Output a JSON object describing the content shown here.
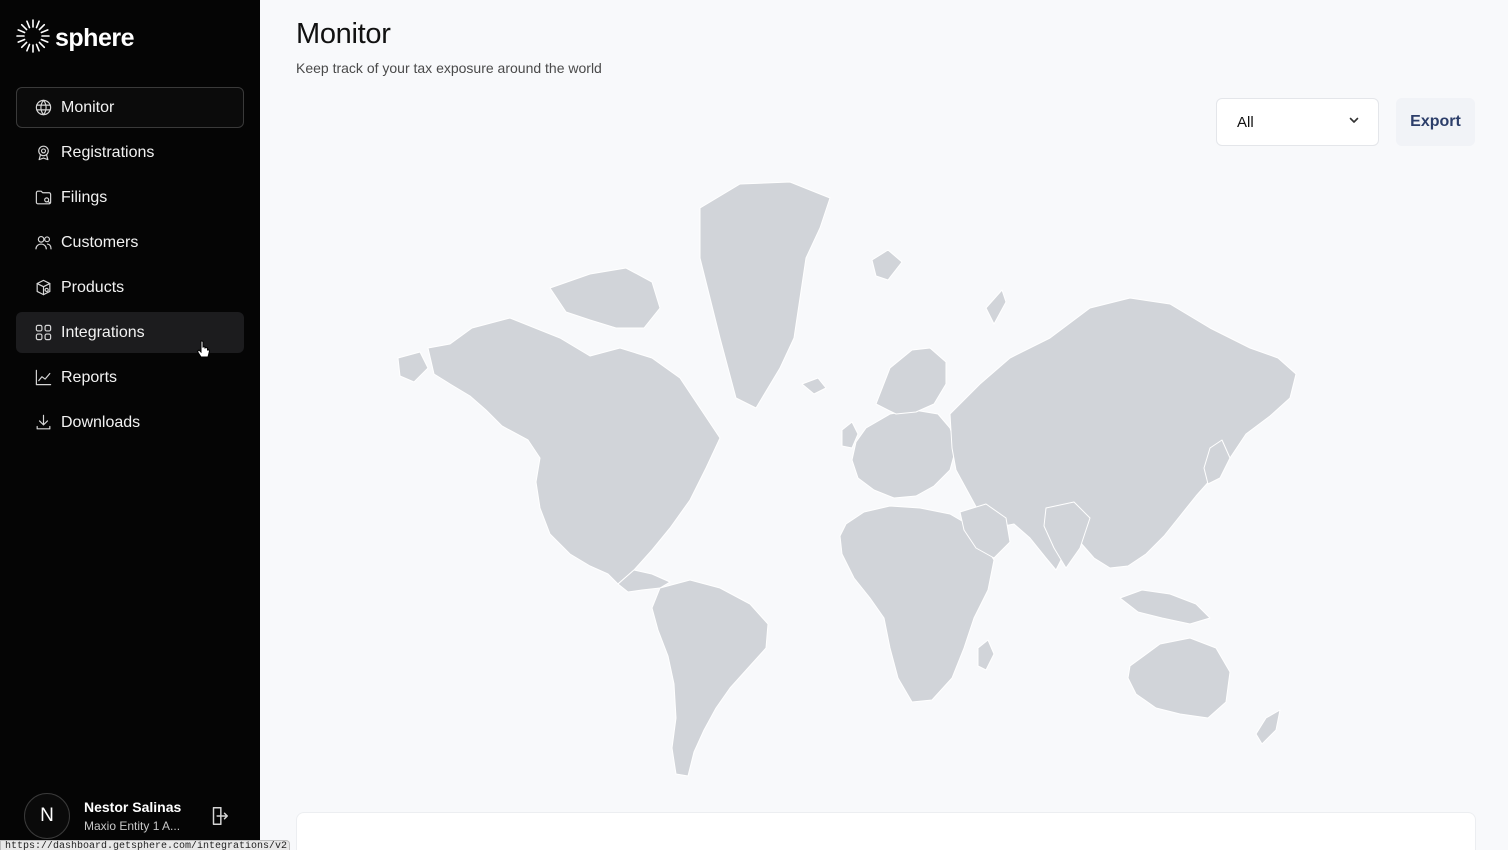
{
  "brand": {
    "name": "sphere"
  },
  "nav": {
    "items": [
      {
        "label": "Monitor",
        "icon": "globe-icon",
        "state": "active"
      },
      {
        "label": "Registrations",
        "icon": "registration-badge-icon",
        "state": ""
      },
      {
        "label": "Filings",
        "icon": "folder-icon",
        "state": ""
      },
      {
        "label": "Customers",
        "icon": "users-icon",
        "state": ""
      },
      {
        "label": "Products",
        "icon": "package-icon",
        "state": ""
      },
      {
        "label": "Integrations",
        "icon": "grid-icon",
        "state": "hover"
      },
      {
        "label": "Reports",
        "icon": "line-chart-icon",
        "state": ""
      },
      {
        "label": "Downloads",
        "icon": "download-icon",
        "state": ""
      }
    ]
  },
  "user": {
    "initial": "N",
    "name": "Nestor Salinas",
    "org": "Maxio Entity 1 A..."
  },
  "page": {
    "title": "Monitor",
    "subtitle": "Keep track of your tax exposure around the world"
  },
  "filter": {
    "selected": "All"
  },
  "actions": {
    "export_label": "Export"
  },
  "status_url": "https://dashboard.getsphere.com/integrations/v2",
  "colors": {
    "sidebar_bg": "#050505",
    "land": "#d1d4d9",
    "export_text": "#2c3e6a",
    "page_bg": "#f8f9fb"
  }
}
